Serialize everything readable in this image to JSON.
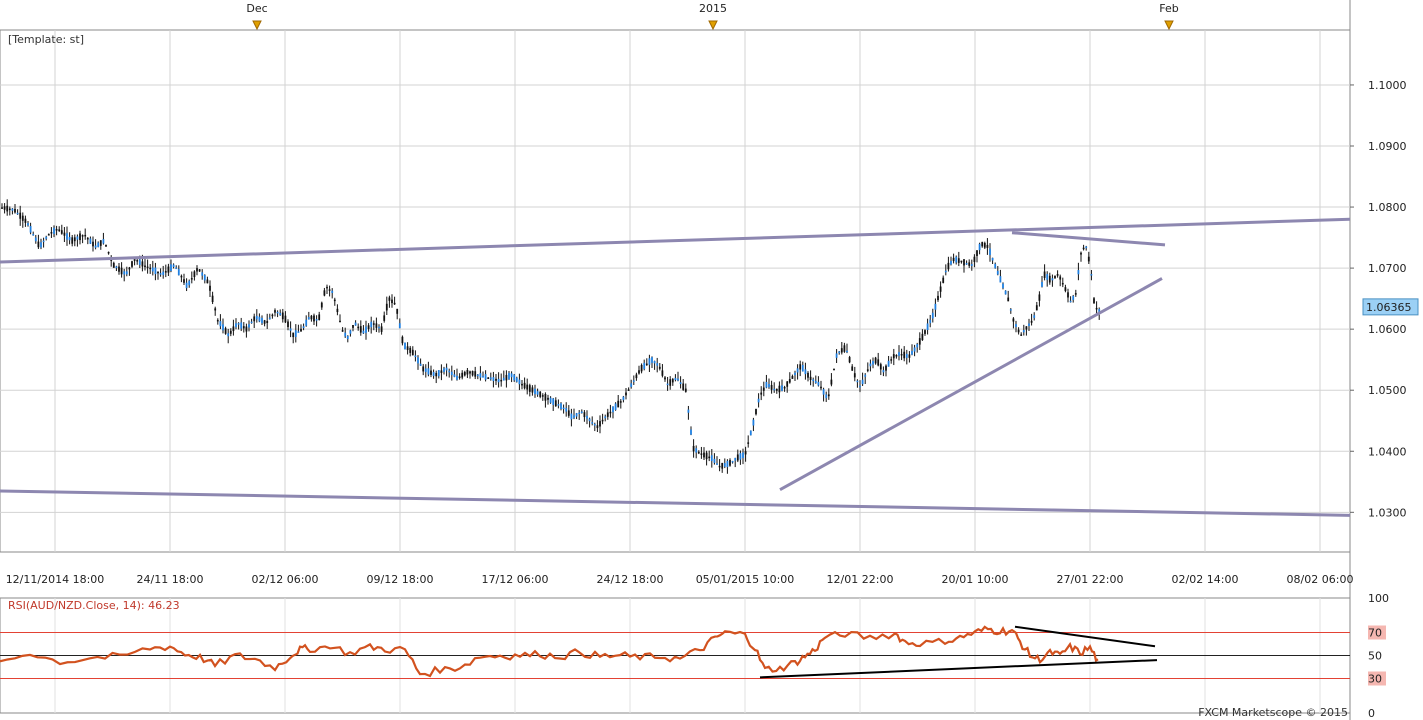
{
  "chart_data": {
    "type": "candlestick",
    "template_label": "Template: st",
    "top_markers": [
      "Dec",
      "2015",
      "Feb"
    ],
    "x_tick_labels": [
      "12/11/2014 18:00",
      "24/11 18:00",
      "02/12 06:00",
      "09/12 18:00",
      "17/12 06:00",
      "24/12 18:00",
      "05/01/2015 10:00",
      "12/01 22:00",
      "20/01 10:00",
      "27/01 22:00",
      "02/02 14:00",
      "08/02 06:00"
    ],
    "y_ticks": [
      "1.1000",
      "1.0900",
      "1.0800",
      "1.0700",
      "1.0600",
      "1.0500",
      "1.0400",
      "1.0300"
    ],
    "ylim": [
      1.0235,
      1.109
    ],
    "current_price": "1.06365",
    "price_path": [
      [
        0,
        1.08
      ],
      [
        8,
        1.0795
      ],
      [
        15,
        1.0775
      ],
      [
        22,
        1.0735
      ],
      [
        27,
        1.0755
      ],
      [
        32,
        1.0765
      ],
      [
        40,
        1.0745
      ],
      [
        47,
        1.0755
      ],
      [
        53,
        1.0735
      ],
      [
        58,
        1.0745
      ],
      [
        63,
        1.0705
      ],
      [
        70,
        1.069
      ],
      [
        75,
        1.0715
      ],
      [
        80,
        1.0705
      ],
      [
        90,
        1.069
      ],
      [
        97,
        1.0705
      ],
      [
        104,
        1.067
      ],
      [
        110,
        1.07
      ],
      [
        116,
        1.0675
      ],
      [
        121,
        1.0615
      ],
      [
        127,
        1.059
      ],
      [
        132,
        1.061
      ],
      [
        137,
        1.06
      ],
      [
        142,
        1.062
      ],
      [
        148,
        1.061
      ],
      [
        153,
        1.063
      ],
      [
        158,
        1.062
      ],
      [
        163,
        1.059
      ],
      [
        168,
        1.06
      ],
      [
        172,
        1.062
      ],
      [
        177,
        1.0615
      ],
      [
        181,
        1.067
      ],
      [
        185,
        1.066
      ],
      [
        190,
        1.06
      ],
      [
        193,
        1.0585
      ],
      [
        197,
        1.061
      ],
      [
        202,
        1.0595
      ],
      [
        207,
        1.061
      ],
      [
        212,
        1.06
      ],
      [
        216,
        1.065
      ],
      [
        220,
        1.064
      ],
      [
        224,
        1.0575
      ],
      [
        230,
        1.056
      ],
      [
        235,
        1.0535
      ],
      [
        242,
        1.0525
      ],
      [
        248,
        1.0535
      ],
      [
        254,
        1.052
      ],
      [
        260,
        1.053
      ],
      [
        266,
        1.0525
      ],
      [
        272,
        1.052
      ],
      [
        278,
        1.0515
      ],
      [
        284,
        1.0525
      ],
      [
        290,
        1.051
      ],
      [
        296,
        1.05
      ],
      [
        302,
        1.049
      ],
      [
        308,
        1.048
      ],
      [
        314,
        1.047
      ],
      [
        318,
        1.0455
      ],
      [
        323,
        1.0465
      ],
      [
        328,
        1.045
      ],
      [
        332,
        1.044
      ],
      [
        336,
        1.0455
      ],
      [
        341,
        1.047
      ],
      [
        346,
        1.0485
      ],
      [
        351,
        1.051
      ],
      [
        356,
        1.0535
      ],
      [
        362,
        1.055
      ],
      [
        366,
        1.054
      ],
      [
        371,
        1.051
      ],
      [
        376,
        1.052
      ],
      [
        381,
        1.05
      ],
      [
        385,
        1.0405
      ],
      [
        390,
        1.0395
      ],
      [
        395,
        1.039
      ],
      [
        400,
        1.0375
      ],
      [
        405,
        1.038
      ],
      [
        410,
        1.039
      ],
      [
        414,
        1.0395
      ],
      [
        418,
        1.044
      ],
      [
        422,
        1.049
      ],
      [
        426,
        1.051
      ],
      [
        431,
        1.05
      ],
      [
        436,
        1.0505
      ],
      [
        440,
        1.052
      ],
      [
        445,
        1.054
      ],
      [
        450,
        1.052
      ],
      [
        455,
        1.051
      ],
      [
        460,
        1.0485
      ],
      [
        465,
        1.056
      ],
      [
        470,
        1.057
      ],
      [
        474,
        1.053
      ],
      [
        478,
        1.0505
      ],
      [
        483,
        1.054
      ],
      [
        487,
        1.055
      ],
      [
        491,
        1.053
      ],
      [
        496,
        1.0555
      ],
      [
        500,
        1.056
      ],
      [
        505,
        1.0555
      ],
      [
        509,
        1.057
      ],
      [
        513,
        1.059
      ],
      [
        518,
        1.062
      ],
      [
        522,
        1.066
      ],
      [
        526,
        1.07
      ],
      [
        530,
        1.0715
      ],
      [
        535,
        1.071
      ],
      [
        540,
        1.0705
      ],
      [
        545,
        1.074
      ],
      [
        549,
        1.0735
      ],
      [
        552,
        1.071
      ],
      [
        556,
        1.068
      ],
      [
        560,
        1.065
      ],
      [
        563,
        1.0615
      ],
      [
        567,
        1.059
      ],
      [
        571,
        1.0605
      ],
      [
        574,
        1.0615
      ],
      [
        577,
        1.0645
      ],
      [
        580,
        1.069
      ],
      [
        584,
        1.068
      ],
      [
        588,
        1.069
      ],
      [
        592,
        1.0665
      ],
      [
        595,
        1.0645
      ],
      [
        598,
        1.066
      ],
      [
        600,
        1.072
      ],
      [
        603,
        1.074
      ],
      [
        606,
        1.07
      ],
      [
        608,
        1.064
      ],
      [
        610,
        1.063
      ]
    ],
    "lines": [
      {
        "name": "upper-channel",
        "points": [
          [
            0,
            1.071
          ],
          [
            1350,
            1.078
          ]
        ]
      },
      {
        "name": "lower-channel",
        "points": [
          [
            0,
            1.0335
          ],
          [
            1350,
            1.0295
          ]
        ]
      },
      {
        "name": "triangle-top",
        "points": [
          [
            1012,
            1.0758
          ],
          [
            1165,
            1.0738
          ]
        ]
      },
      {
        "name": "triangle-bottom",
        "points": [
          [
            780,
            1.0337
          ],
          [
            1162,
            1.0683
          ]
        ]
      }
    ],
    "rsi": {
      "title": "RSI(AUD/NZD.Close, 14): 46.23",
      "levels": [
        "100",
        "70",
        "50",
        "30",
        "0"
      ],
      "path": [
        [
          0,
          45
        ],
        [
          30,
          52
        ],
        [
          60,
          44
        ],
        [
          90,
          48
        ],
        [
          120,
          49
        ],
        [
          150,
          56
        ],
        [
          170,
          58
        ],
        [
          185,
          51
        ],
        [
          200,
          49
        ],
        [
          215,
          41
        ],
        [
          235,
          50
        ],
        [
          255,
          47
        ],
        [
          275,
          39
        ],
        [
          290,
          49
        ],
        [
          300,
          56
        ],
        [
          310,
          55
        ],
        [
          330,
          58
        ],
        [
          350,
          52
        ],
        [
          370,
          58
        ],
        [
          385,
          55
        ],
        [
          405,
          55
        ],
        [
          420,
          34
        ],
        [
          440,
          37
        ],
        [
          460,
          40
        ],
        [
          480,
          49
        ],
        [
          500,
          50
        ],
        [
          520,
          50
        ],
        [
          540,
          51
        ],
        [
          560,
          49
        ],
        [
          580,
          53
        ],
        [
          600,
          49
        ],
        [
          620,
          50
        ],
        [
          640,
          48
        ],
        [
          660,
          49
        ],
        [
          680,
          47
        ],
        [
          700,
          55
        ],
        [
          715,
          65
        ],
        [
          725,
          70
        ],
        [
          745,
          68
        ],
        [
          755,
          56
        ],
        [
          765,
          38
        ],
        [
          780,
          39
        ],
        [
          795,
          44
        ],
        [
          805,
          49
        ],
        [
          815,
          55
        ],
        [
          825,
          66
        ],
        [
          845,
          68
        ],
        [
          870,
          66
        ],
        [
          895,
          69
        ],
        [
          905,
          62
        ],
        [
          920,
          60
        ],
        [
          945,
          62
        ],
        [
          960,
          66
        ],
        [
          975,
          70
        ],
        [
          988,
          73
        ],
        [
          1000,
          71
        ],
        [
          1012,
          72
        ],
        [
          1020,
          62
        ],
        [
          1030,
          50
        ],
        [
          1040,
          46
        ],
        [
          1050,
          53
        ],
        [
          1060,
          50
        ],
        [
          1070,
          58
        ],
        [
          1080,
          52
        ],
        [
          1090,
          57
        ],
        [
          1098,
          45
        ]
      ],
      "lines": [
        {
          "name": "rsi-top",
          "points": [
            [
              1015,
              75
            ],
            [
              1155,
              58
            ]
          ]
        },
        {
          "name": "rsi-bottom",
          "points": [
            [
              760,
              31
            ],
            [
              1157,
              46
            ]
          ]
        }
      ]
    },
    "watermark": "FXCM Marketscope © 2015"
  }
}
